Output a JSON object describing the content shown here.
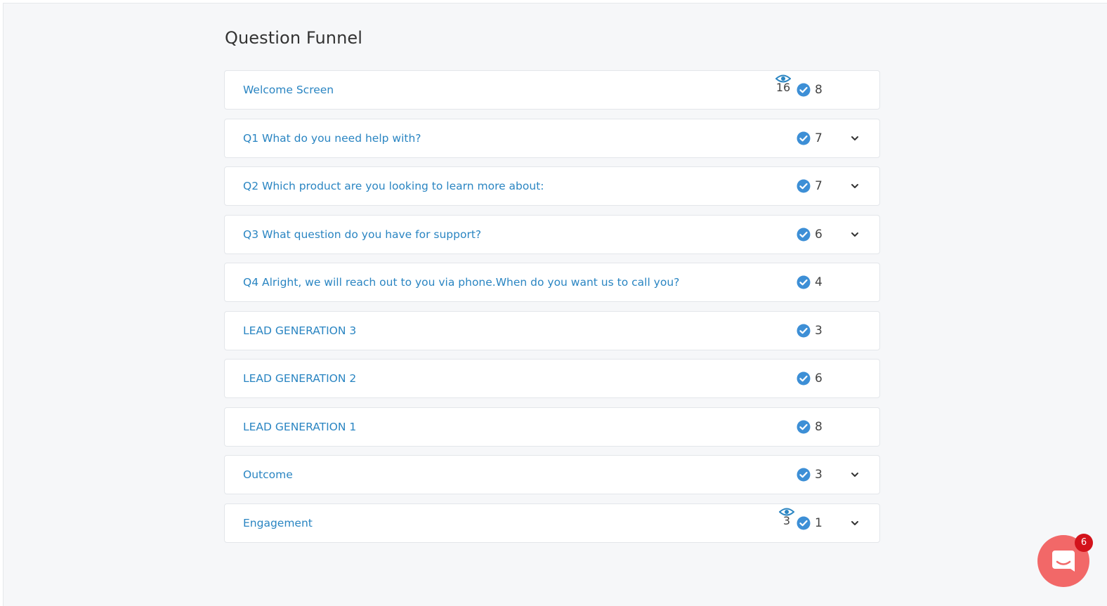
{
  "page": {
    "title": "Question Funnel"
  },
  "funnel": {
    "rows": [
      {
        "label": "Welcome Screen",
        "views": "16",
        "count": "8",
        "has_chevron": false
      },
      {
        "label": "Q1  What do you need help with?",
        "views": null,
        "count": "7",
        "has_chevron": true
      },
      {
        "label": "Q2  Which product are you looking to learn more about:",
        "views": null,
        "count": "7",
        "has_chevron": true
      },
      {
        "label": "Q3  What question do you have for support?",
        "views": null,
        "count": "6",
        "has_chevron": true
      },
      {
        "label": "Q4  Alright, we will reach out to you via phone.When do you want us to call you?",
        "views": null,
        "count": "4",
        "has_chevron": false
      },
      {
        "label": "LEAD GENERATION 3",
        "views": null,
        "count": "3",
        "has_chevron": false
      },
      {
        "label": "LEAD GENERATION 2",
        "views": null,
        "count": "6",
        "has_chevron": false
      },
      {
        "label": "LEAD GENERATION 1",
        "views": null,
        "count": "8",
        "has_chevron": false
      },
      {
        "label": "Outcome",
        "views": null,
        "count": "3",
        "has_chevron": true
      },
      {
        "label": "Engagement",
        "views": "3",
        "count": "1",
        "has_chevron": true
      }
    ]
  },
  "icons": {
    "views": "eye-icon",
    "completed": "check-circle-icon",
    "expand": "chevron-down-icon",
    "chat": "chat-bubble-icon"
  },
  "colors": {
    "label": "#2a85c2",
    "check": "#3d8fd6",
    "eye": "#2a85c2",
    "chat_launcher": "#f26868",
    "badge": "#d3131b"
  },
  "chat": {
    "badge_count": "6"
  }
}
